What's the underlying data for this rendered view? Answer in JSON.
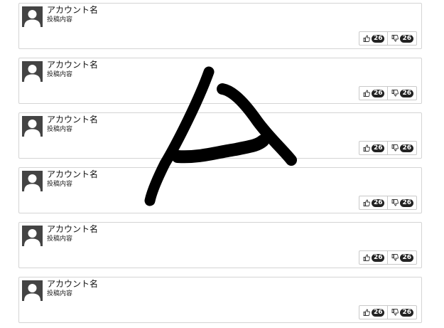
{
  "posts": [
    {
      "account_name": "アカウント名",
      "content": "投稿内容",
      "likes": "26",
      "dislikes": "26"
    },
    {
      "account_name": "アカウント名",
      "content": "投稿内容",
      "likes": "26",
      "dislikes": "26"
    },
    {
      "account_name": "アカウント名",
      "content": "投稿内容",
      "likes": "26",
      "dislikes": "26"
    },
    {
      "account_name": "アカウント名",
      "content": "投稿内容",
      "likes": "26",
      "dislikes": "26"
    },
    {
      "account_name": "アカウント名",
      "content": "投稿内容",
      "likes": "26",
      "dislikes": "26"
    },
    {
      "account_name": "アカウント名",
      "content": "投稿内容",
      "likes": "26",
      "dislikes": "26"
    }
  ],
  "icons": {
    "avatar": "user-silhouette-icon",
    "like": "thumbs-up-icon",
    "dislike": "thumbs-down-icon"
  },
  "colors": {
    "card_border": "#d4d4d4",
    "avatar_bg": "#444444",
    "badge_bg": "#222222",
    "scribble": "#000000"
  }
}
